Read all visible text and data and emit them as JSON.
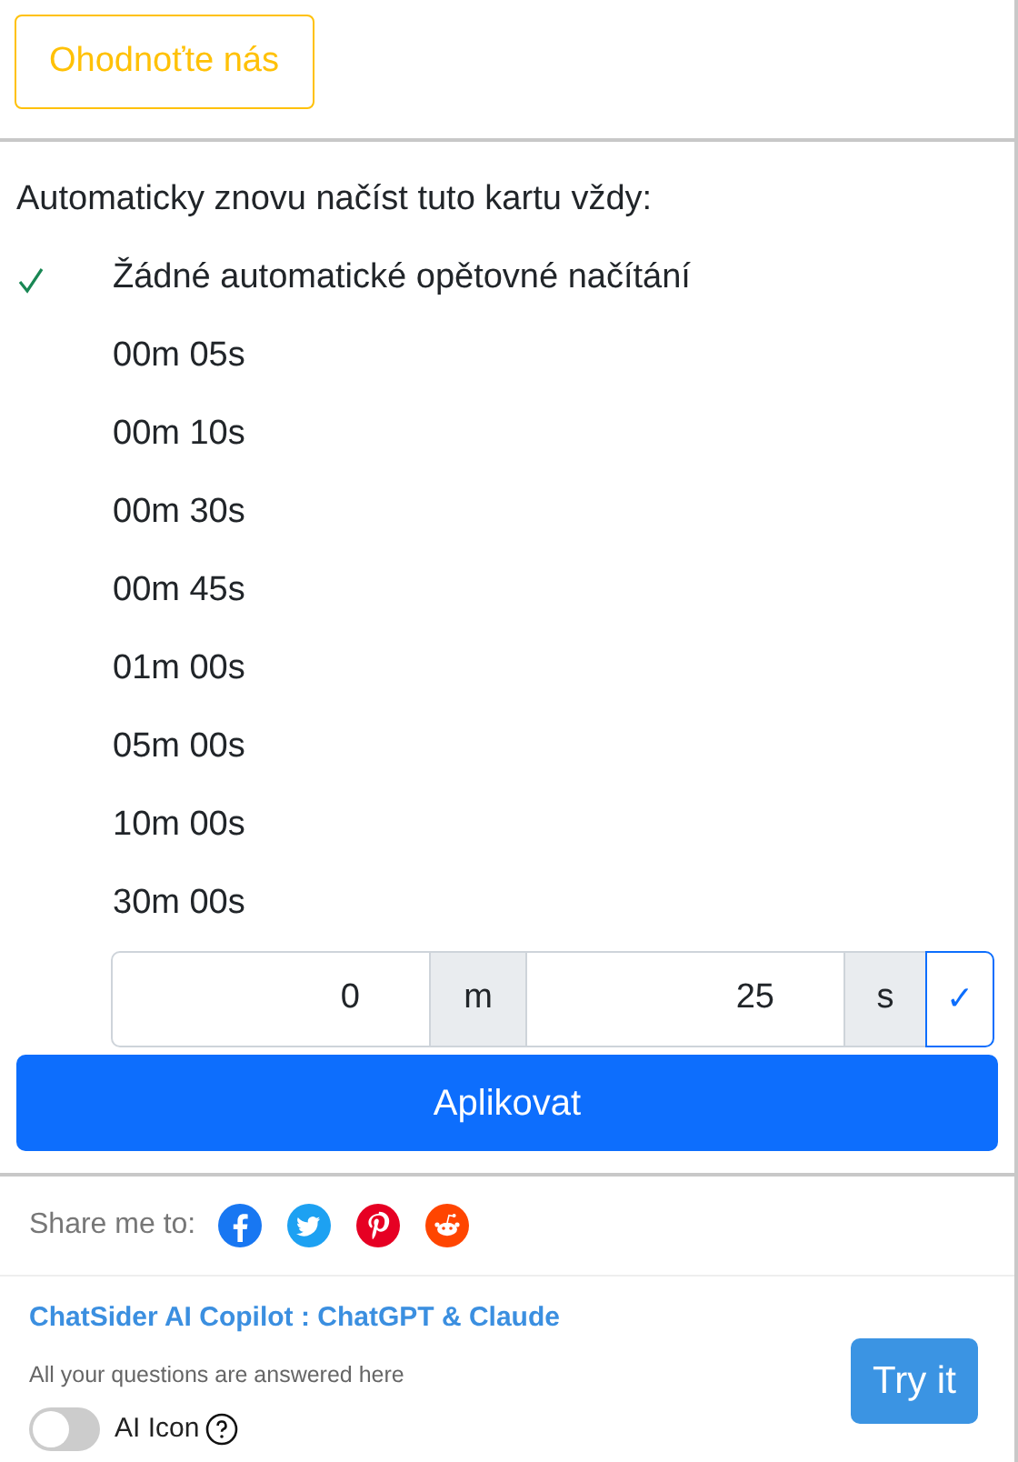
{
  "rate_button": "Ohodnoťte nás",
  "heading": "Automaticky znovu načíst tuto kartu vždy:",
  "options": [
    {
      "label": "Žádné automatické opětovné načítání",
      "selected": true
    },
    {
      "label": "00m 05s",
      "selected": false
    },
    {
      "label": "00m 10s",
      "selected": false
    },
    {
      "label": "00m 30s",
      "selected": false
    },
    {
      "label": "00m 45s",
      "selected": false
    },
    {
      "label": "01m 00s",
      "selected": false
    },
    {
      "label": "05m 00s",
      "selected": false
    },
    {
      "label": "10m 00s",
      "selected": false
    },
    {
      "label": "30m 00s",
      "selected": false
    }
  ],
  "custom": {
    "minutes": "0",
    "minutes_unit": "m",
    "seconds": "25",
    "seconds_unit": "s",
    "confirm": "✓"
  },
  "apply_button": "Aplikovat",
  "share": {
    "label": "Share me to:",
    "networks": [
      {
        "kind": "facebook",
        "color": "#1877f2"
      },
      {
        "kind": "twitter",
        "color": "#1da1f2"
      },
      {
        "kind": "pinterest",
        "color": "#e60023"
      },
      {
        "kind": "reddit",
        "color": "#ff4500"
      }
    ]
  },
  "promo": {
    "title": "ChatSider AI Copilot : ChatGPT & Claude",
    "subtitle": "All your questions are answered here",
    "toggle_label": "AI Icon",
    "toggle_on": false,
    "button": "Try it"
  }
}
